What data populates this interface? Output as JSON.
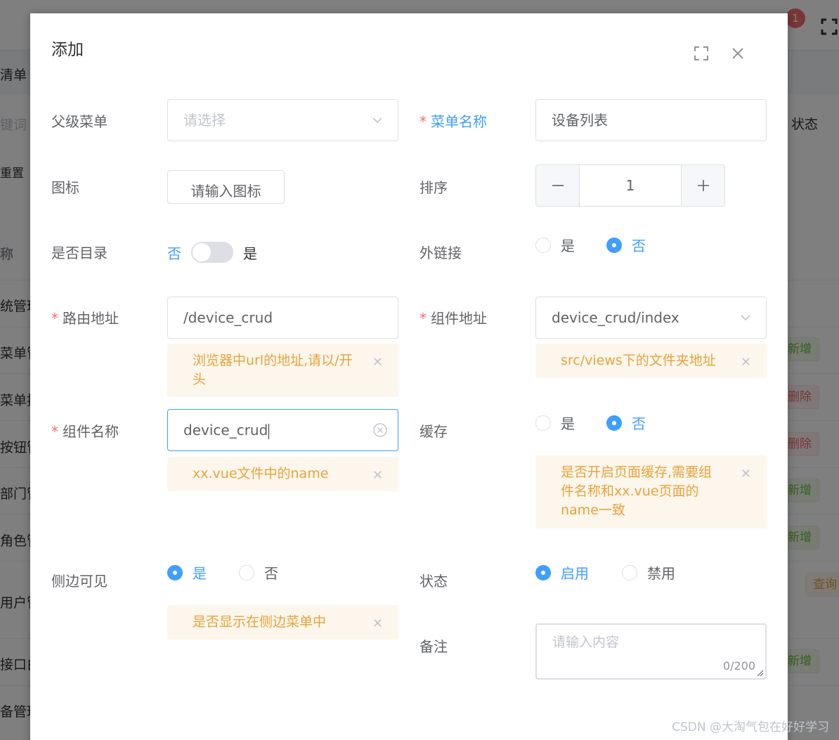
{
  "background": {
    "notification_count": "1",
    "tab_partial": "清单",
    "search_partial": "键词",
    "reset_partial": "重置",
    "status_partial": "状态",
    "name_col_partial": "称",
    "rows": [
      "统管理",
      "菜单管",
      "菜单按",
      "按钮管",
      "部门管",
      "角色管",
      "用户管",
      "接口白",
      "备管理"
    ],
    "tags": {
      "add": "新增",
      "delete": "删除",
      "query": "查询"
    }
  },
  "dialog": {
    "title": "添加",
    "fields": {
      "parent_menu": {
        "label": "父级菜单",
        "placeholder": "请选择"
      },
      "menu_name": {
        "label": "菜单名称",
        "value": "设备列表"
      },
      "icon": {
        "label": "图标",
        "button": "请输入图标"
      },
      "sort": {
        "label": "排序",
        "value": "1"
      },
      "is_directory": {
        "label": "是否目录",
        "off_text": "否",
        "on_text": "是"
      },
      "external_link": {
        "label": "外链接",
        "options": [
          "是",
          "否"
        ],
        "selected": "否"
      },
      "route_path": {
        "label": "路由地址",
        "value": "/device_crud",
        "hint": "浏览器中url的地址,请以/开头"
      },
      "component_path": {
        "label": "组件地址",
        "value": "device_crud/index",
        "hint": "src/views下的文件夹地址"
      },
      "component_name": {
        "label": "组件名称",
        "value": "device_crud",
        "hint": "xx.vue文件中的name"
      },
      "cache": {
        "label": "缓存",
        "options": [
          "是",
          "否"
        ],
        "selected": "否",
        "hint": "是否开启页面缓存,需要组件名称和xx.vue页面的name一致"
      },
      "sidebar_visible": {
        "label": "侧边可见",
        "options": [
          "是",
          "否"
        ],
        "selected": "是",
        "hint": "是否显示在侧边菜单中"
      },
      "status": {
        "label": "状态",
        "options": [
          "启用",
          "禁用"
        ],
        "selected": "启用"
      },
      "remark": {
        "label": "备注",
        "placeholder": "请输入内容",
        "count": "0/200"
      }
    }
  },
  "watermark": "CSDN @大淘气包在好好学习",
  "colors": {
    "primary": "#409eff",
    "warning": "#e6a23c",
    "danger": "#f56c6c",
    "success": "#67c23a"
  }
}
